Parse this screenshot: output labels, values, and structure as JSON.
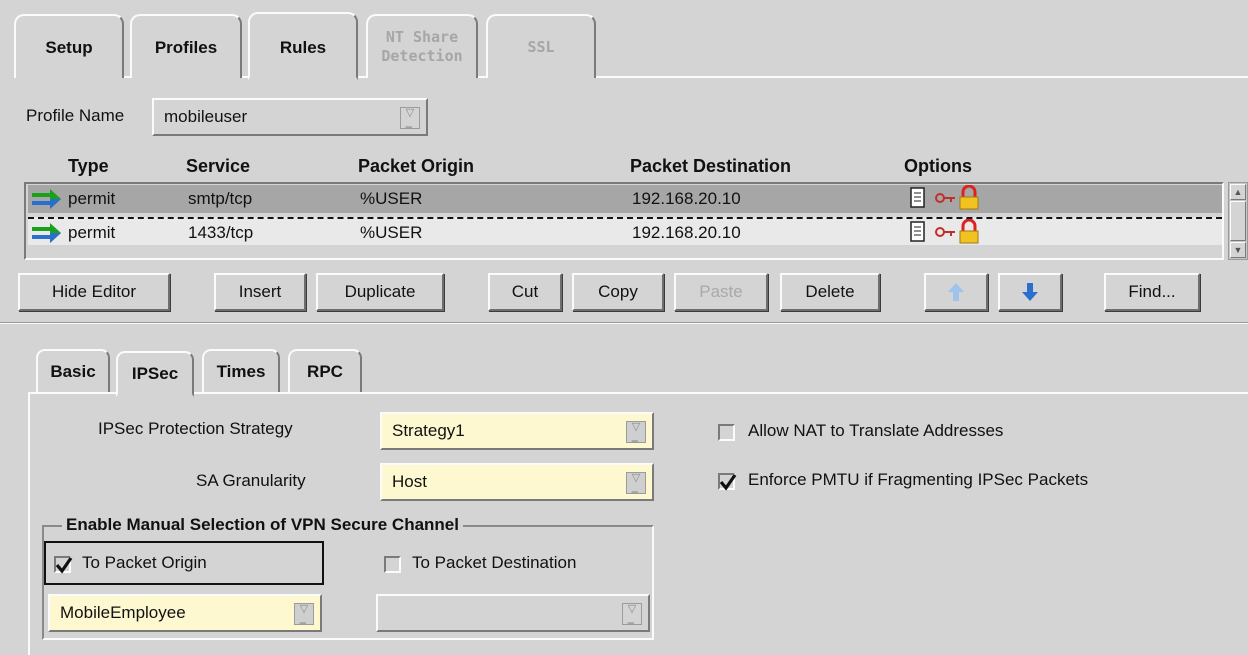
{
  "top_tabs": [
    "Setup",
    "Profiles",
    "Rules",
    "NT Share Detection",
    "SSL"
  ],
  "profile": {
    "label": "Profile Name",
    "value": "mobileuser"
  },
  "table": {
    "headers": [
      "Type",
      "Service",
      "Packet Origin",
      "Packet Destination",
      "Options"
    ],
    "rows": [
      {
        "type": "permit",
        "service": "smtp/tcp",
        "origin": "%USER",
        "destination": "192.168.20.10"
      },
      {
        "type": "permit",
        "service": "1433/tcp",
        "origin": "%USER",
        "destination": "192.168.20.10"
      }
    ]
  },
  "buttons": {
    "hide_editor": "Hide Editor",
    "insert": "Insert",
    "duplicate": "Duplicate",
    "cut": "Cut",
    "copy": "Copy",
    "paste": "Paste",
    "delete": "Delete",
    "find": "Find..."
  },
  "inner_tabs": [
    "Basic",
    "IPSec",
    "Times",
    "RPC"
  ],
  "ipsec": {
    "strategy_label": "IPSec Protection Strategy",
    "strategy_value": "Strategy1",
    "granularity_label": "SA Granularity",
    "granularity_value": "Host",
    "allow_nat_label": "Allow NAT to Translate Addresses",
    "allow_nat_checked": false,
    "pmtu_label": "Enforce PMTU if Fragmenting IPSec Packets",
    "pmtu_checked": true,
    "group_title": "Enable Manual Selection of VPN Secure Channel",
    "to_origin_label": "To Packet Origin",
    "to_origin_checked": true,
    "to_destination_label": "To Packet Destination",
    "to_destination_checked": false,
    "origin_channel": "MobileEmployee",
    "destination_channel": ""
  },
  "colors": {
    "background": "#d4d4d4",
    "selected_row": "#a6a6a6",
    "input_yellow": "#fdf8cf",
    "arrow_green": "#1aa01a",
    "arrow_blue": "#2a6fd0",
    "lock_red": "#e02020"
  },
  "icons": {
    "rule_type": "permit-arrow-icon",
    "options": [
      "document-icon",
      "key-icon",
      "lock-icon"
    ],
    "move_up": "arrow-up-icon",
    "move_down": "arrow-down-icon"
  }
}
